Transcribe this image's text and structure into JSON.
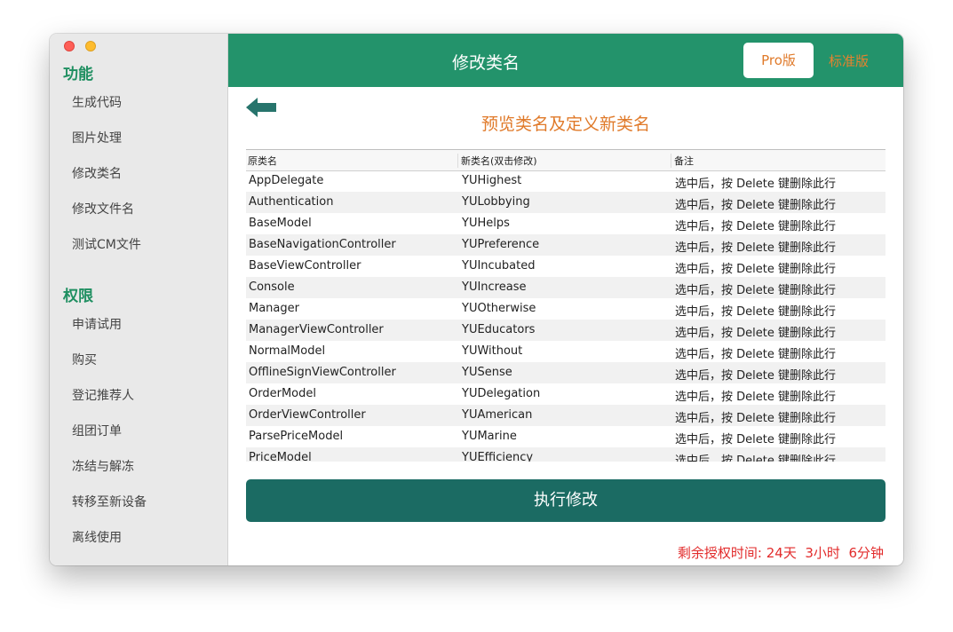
{
  "sidebar": {
    "section1_title": "功能",
    "section1_items": [
      "生成代码",
      "图片处理",
      "修改类名",
      "修改文件名",
      "测试CM文件"
    ],
    "section2_title": "权限",
    "section2_items": [
      "申请试用",
      "购买",
      "登记推荐人",
      "组团订单",
      "冻结与解冻",
      "转移至新设备",
      "离线使用"
    ]
  },
  "header": {
    "title": "修改类名",
    "pro_label": "Pro版",
    "standard_label": "标准版"
  },
  "back_icon": "arrow-left-icon",
  "subtitle": "预览类名及定义新类名",
  "table": {
    "headers": [
      "原类名",
      "新类名(双击修改)",
      "备注"
    ],
    "rows": [
      [
        "AppDelegate",
        "YUHighest",
        "选中后，按 Delete 键删除此行"
      ],
      [
        "Authentication",
        "YULobbying",
        "选中后，按 Delete 键删除此行"
      ],
      [
        "BaseModel",
        "YUHelps",
        "选中后，按 Delete 键删除此行"
      ],
      [
        "BaseNavigationController",
        "YUPreference",
        "选中后，按 Delete 键删除此行"
      ],
      [
        "BaseViewController",
        "YUIncubated",
        "选中后，按 Delete 键删除此行"
      ],
      [
        "Console",
        "YUIncrease",
        "选中后，按 Delete 键删除此行"
      ],
      [
        "Manager",
        "YUOtherwise",
        "选中后，按 Delete 键删除此行"
      ],
      [
        "ManagerViewController",
        "YUEducators",
        "选中后，按 Delete 键删除此行"
      ],
      [
        "NormalModel",
        "YUWithout",
        "选中后，按 Delete 键删除此行"
      ],
      [
        "OfflineSignViewController",
        "YUSense",
        "选中后，按 Delete 键删除此行"
      ],
      [
        "OrderModel",
        "YUDelegation",
        "选中后，按 Delete 键删除此行"
      ],
      [
        "OrderViewController",
        "YUAmerican",
        "选中后，按 Delete 键删除此行"
      ],
      [
        "ParsePriceModel",
        "YUMarine",
        "选中后，按 Delete 键删除此行"
      ],
      [
        "PriceModel",
        "YUEfficiency",
        "选中后，按 Delete 键删除此行"
      ]
    ]
  },
  "execute_label": "执行修改",
  "remaining": "剩余授权时间: 24天  3小时  6分钟",
  "colors": {
    "accent": "#23936b",
    "header_orange": "#e07a2a",
    "execute_button": "#1b6b63",
    "warning_red": "#e22b2b"
  }
}
